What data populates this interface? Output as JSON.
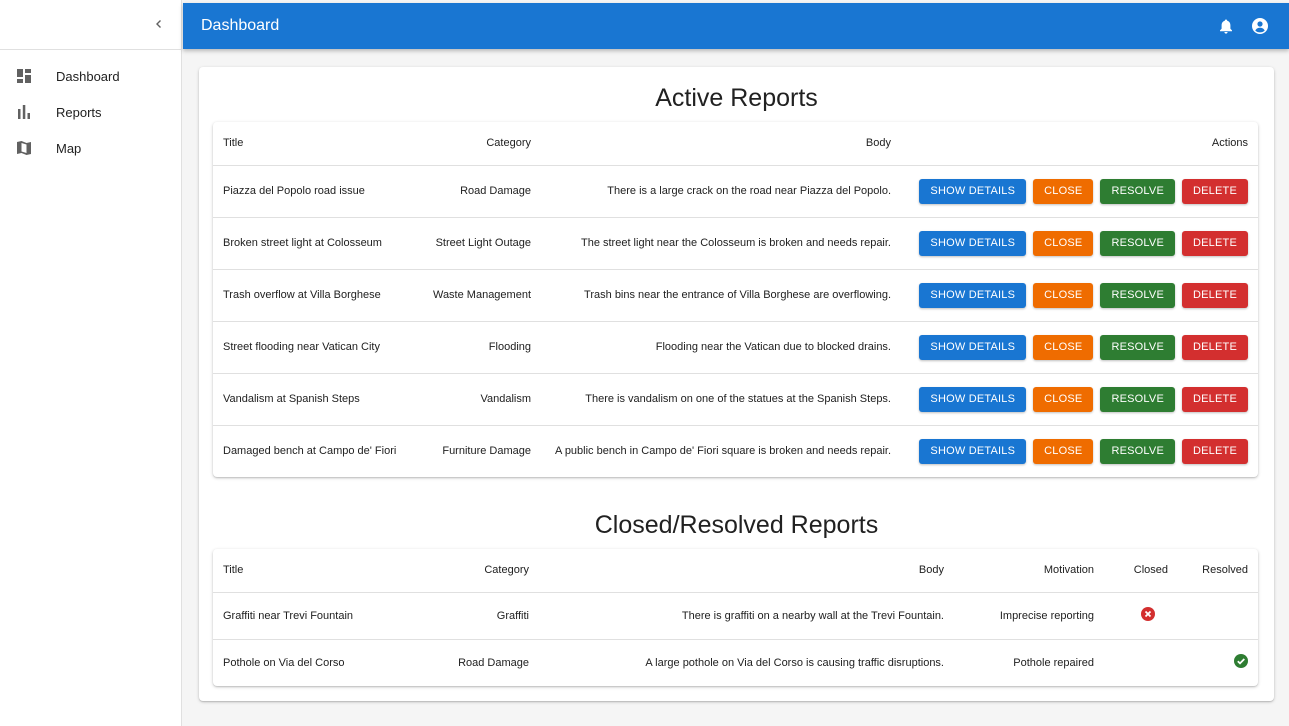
{
  "app": {
    "title": "Dashboard"
  },
  "sidebar": {
    "items": [
      {
        "label": "Dashboard",
        "icon": "dashboard-icon"
      },
      {
        "label": "Reports",
        "icon": "bar-chart-icon"
      },
      {
        "label": "Map",
        "icon": "map-icon"
      }
    ]
  },
  "colors": {
    "primary": "#1976d2",
    "close": "#ef6c00",
    "resolve": "#2e7d32",
    "delete": "#d32f2f"
  },
  "active": {
    "title": "Active Reports",
    "headers": {
      "title": "Title",
      "category": "Category",
      "body": "Body",
      "actions": "Actions"
    },
    "buttons": {
      "details": "SHOW DETAILS",
      "close": "CLOSE",
      "resolve": "RESOLVE",
      "delete": "DELETE"
    },
    "rows": [
      {
        "title": "Piazza del Popolo road issue",
        "category": "Road Damage",
        "body": "There is a large crack on the road near Piazza del Popolo."
      },
      {
        "title": "Broken street light at Colosseum",
        "category": "Street Light Outage",
        "body": "The street light near the Colosseum is broken and needs repair."
      },
      {
        "title": "Trash overflow at Villa Borghese",
        "category": "Waste Management",
        "body": "Trash bins near the entrance of Villa Borghese are overflowing."
      },
      {
        "title": "Street flooding near Vatican City",
        "category": "Flooding",
        "body": "Flooding near the Vatican due to blocked drains."
      },
      {
        "title": "Vandalism at Spanish Steps",
        "category": "Vandalism",
        "body": "There is vandalism on one of the statues at the Spanish Steps."
      },
      {
        "title": "Damaged bench at Campo de' Fiori",
        "category": "Furniture Damage",
        "body": "A public bench in Campo de' Fiori square is broken and needs repair."
      }
    ]
  },
  "closed": {
    "title": "Closed/Resolved Reports",
    "headers": {
      "title": "Title",
      "category": "Category",
      "body": "Body",
      "motivation": "Motivation",
      "closed": "Closed",
      "resolved": "Resolved"
    },
    "rows": [
      {
        "title": "Graffiti near Trevi Fountain",
        "category": "Graffiti",
        "body": "There is graffiti on a nearby wall at the Trevi Fountain.",
        "motivation": "Imprecise reporting",
        "closed": true,
        "resolved": false
      },
      {
        "title": "Pothole on Via del Corso",
        "category": "Road Damage",
        "body": "A large pothole on Via del Corso is causing traffic disruptions.",
        "motivation": "Pothole repaired",
        "closed": false,
        "resolved": true
      }
    ]
  }
}
